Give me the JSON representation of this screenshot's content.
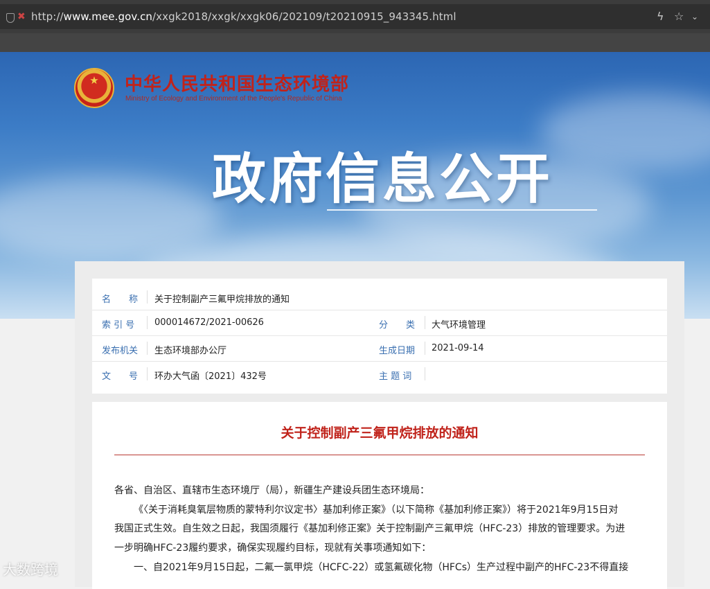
{
  "browser": {
    "url_prefix": "http://",
    "url_host": "www.mee.gov.cn",
    "url_path": "/xxgk2018/xxgk/xxgk06/202109/t20210915_943345.html"
  },
  "header": {
    "ministry_cn": "中华人民共和国生态环境部",
    "ministry_en": "Ministry of Ecology and Environment of the People's Republic of China",
    "section_title": "政府信息公开"
  },
  "meta": {
    "name_label": "名　　称",
    "name_value": "关于控制副产三氟甲烷排放的通知",
    "index_label": "索 引 号",
    "index_value": "000014672/2021-00626",
    "category_label": "分　　类",
    "category_value": "大气环境管理",
    "issuer_label": "发布机关",
    "issuer_value": "生态环境部办公厅",
    "date_label": "生成日期",
    "date_value": "2021-09-14",
    "docno_label": "文　　号",
    "docno_value": "环办大气函〔2021〕432号",
    "keywords_label": "主 题 词",
    "keywords_value": ""
  },
  "document": {
    "title": "关于控制副产三氟甲烷排放的通知",
    "salutation": "各省、自治区、直辖市生态环境厅（局），新疆生产建设兵团生态环境局：",
    "para1_line1": "《〈关于消耗臭氧层物质的蒙特利尔议定书〉基加利修正案》（以下简称《基加利修正案》）将于2021年9月15日对",
    "para1_line2": "我国正式生效。自生效之日起，我国须履行《基加利修正案》关于控制副产三氟甲烷（HFC-23）排放的管理要求。为进",
    "para1_line3": "一步明确HFC-23履约要求，确保实现履约目标，现就有关事项通知如下：",
    "para2_line1": "一、自2021年9月15日起，二氟一氯甲烷（HCFC-22）或氢氟碳化物（HFCs）生产过程中副产的HFC-23不得直接"
  },
  "watermark": "大数跨境"
}
